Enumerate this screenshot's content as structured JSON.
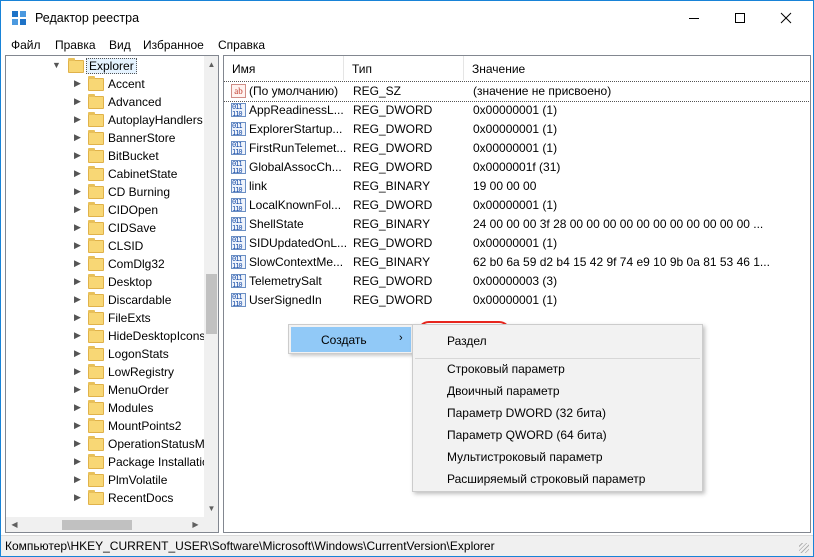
{
  "window": {
    "title": "Редактор реестра",
    "icon": "regedit-icon",
    "controls": [
      "minimize-icon",
      "maximize-icon",
      "close-icon"
    ]
  },
  "menu": [
    "Файл",
    "Правка",
    "Вид",
    "Избранное",
    "Справка"
  ],
  "tree": {
    "selected": "Explorer",
    "items": [
      "Accent",
      "Advanced",
      "AutoplayHandlers",
      "BannerStore",
      "BitBucket",
      "CabinetState",
      "CD Burning",
      "CIDOpen",
      "CIDSave",
      "CLSID",
      "ComDlg32",
      "Desktop",
      "Discardable",
      "FileExts",
      "HideDesktopIcons",
      "LogonStats",
      "LowRegistry",
      "MenuOrder",
      "Modules",
      "MountPoints2",
      "OperationStatusM",
      "Package Installatio",
      "PlmVolatile",
      "RecentDocs"
    ]
  },
  "list": {
    "columns": [
      "Имя",
      "Тип",
      "Значение"
    ],
    "rows": [
      {
        "name": "(По умолчанию)",
        "type": "REG_SZ",
        "value": "(значение не присвоено)",
        "icon": "string-value-icon"
      },
      {
        "name": "AppReadinessL...",
        "type": "REG_DWORD",
        "value": "0x00000001 (1)",
        "icon": "binary-value-icon"
      },
      {
        "name": "ExplorerStartup...",
        "type": "REG_DWORD",
        "value": "0x00000001 (1)",
        "icon": "binary-value-icon"
      },
      {
        "name": "FirstRunTelemet...",
        "type": "REG_DWORD",
        "value": "0x00000001 (1)",
        "icon": "binary-value-icon"
      },
      {
        "name": "GlobalAssocCh...",
        "type": "REG_DWORD",
        "value": "0x0000001f (31)",
        "icon": "binary-value-icon"
      },
      {
        "name": "link",
        "type": "REG_BINARY",
        "value": "19 00 00 00",
        "icon": "binary-value-icon"
      },
      {
        "name": "LocalKnownFol...",
        "type": "REG_DWORD",
        "value": "0x00000001 (1)",
        "icon": "binary-value-icon"
      },
      {
        "name": "ShellState",
        "type": "REG_BINARY",
        "value": "24 00 00 00 3f 28 00 00 00 00 00 00 00 00 00 00 00 ...",
        "icon": "binary-value-icon"
      },
      {
        "name": "SIDUpdatedOnL...",
        "type": "REG_DWORD",
        "value": "0x00000001 (1)",
        "icon": "binary-value-icon"
      },
      {
        "name": "SlowContextMe...",
        "type": "REG_BINARY",
        "value": "62 b0 6a 59 d2 b4 15 42 9f 74 e9 10 9b 0a 81 53 46 1...",
        "icon": "binary-value-icon"
      },
      {
        "name": "TelemetrySalt",
        "type": "REG_DWORD",
        "value": "0x00000003 (3)",
        "icon": "binary-value-icon"
      },
      {
        "name": "UserSignedIn",
        "type": "REG_DWORD",
        "value": "0x00000001 (1)",
        "icon": "binary-value-icon"
      }
    ]
  },
  "context_menu": {
    "item": "Создать",
    "submenu": {
      "first": "Раздел",
      "items": [
        "Строковый параметр",
        "Двоичный параметр",
        "Параметр DWORD (32 бита)",
        "Параметр QWORD (64 бита)",
        "Мультистроковый параметр",
        "Расширяемый строковый параметр"
      ]
    }
  },
  "status": "Компьютер\\HKEY_CURRENT_USER\\Software\\Microsoft\\Windows\\CurrentVersion\\Explorer",
  "colors": {
    "accent_border": "#1883d7",
    "menu_highlight": "#91c9f7",
    "annotation_red": "#e8261e",
    "folder_yellow": "#f8d775"
  }
}
